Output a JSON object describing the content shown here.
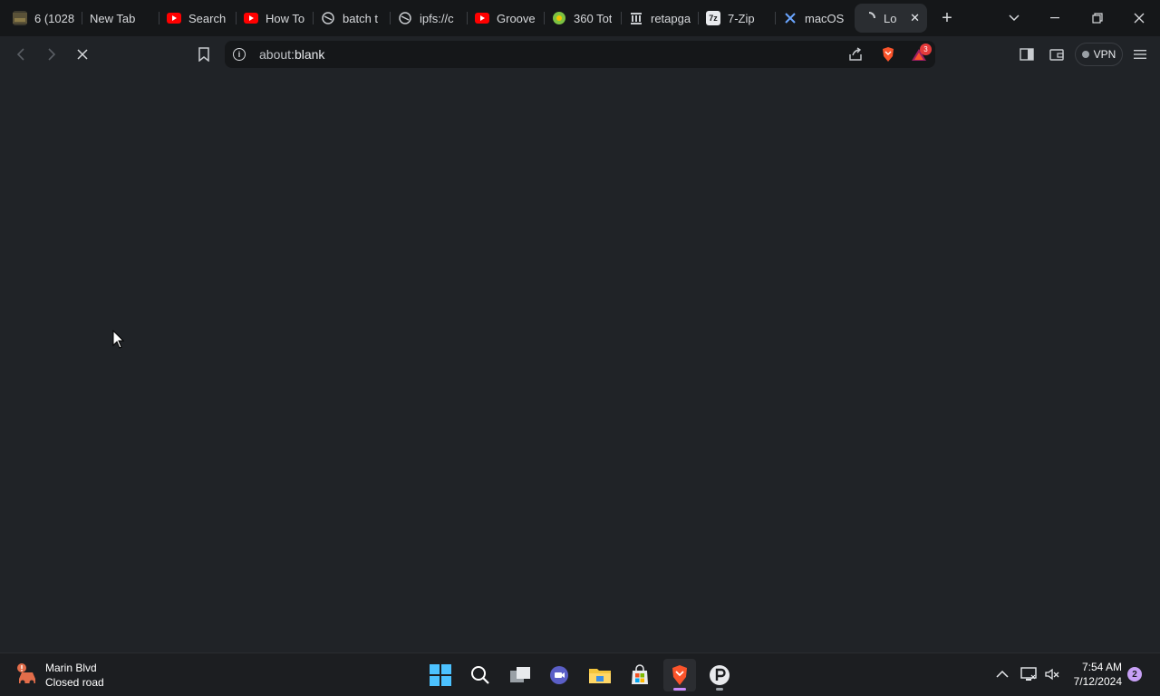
{
  "tabs": [
    {
      "title": "6 (1028",
      "icon": "thumbnail-icon"
    },
    {
      "title": "New Tab",
      "icon": ""
    },
    {
      "title": "Search",
      "icon": "youtube-icon"
    },
    {
      "title": "How To",
      "icon": "youtube-icon"
    },
    {
      "title": "batch t",
      "icon": "globe-icon"
    },
    {
      "title": "ipfs://c",
      "icon": "globe-icon"
    },
    {
      "title": "Groove",
      "icon": "youtube-icon"
    },
    {
      "title": "360 Tot",
      "icon": "360-icon"
    },
    {
      "title": "retapga",
      "icon": "bank-icon"
    },
    {
      "title": "7-Zip",
      "icon": "7zip-icon"
    },
    {
      "title": "macOS",
      "icon": "x-logo-icon"
    },
    {
      "title": "Lo",
      "icon": "loading-spinner-icon",
      "active": true
    }
  ],
  "address": {
    "url_prefix": "about:",
    "url_rest": "blank"
  },
  "toolbar": {
    "vpn_label": "VPN",
    "rewards_badge": "3"
  },
  "taskbar": {
    "widget_title": "Marin Blvd",
    "widget_subtitle": "Closed road",
    "time": "7:54 AM",
    "date": "7/12/2024",
    "notification_count": "2"
  },
  "colors": {
    "tabstrip": "#151719",
    "content": "#202327",
    "taskbar": "#1c1e21",
    "youtube_red": "#ff0000",
    "brave_orange": "#fb542b"
  }
}
